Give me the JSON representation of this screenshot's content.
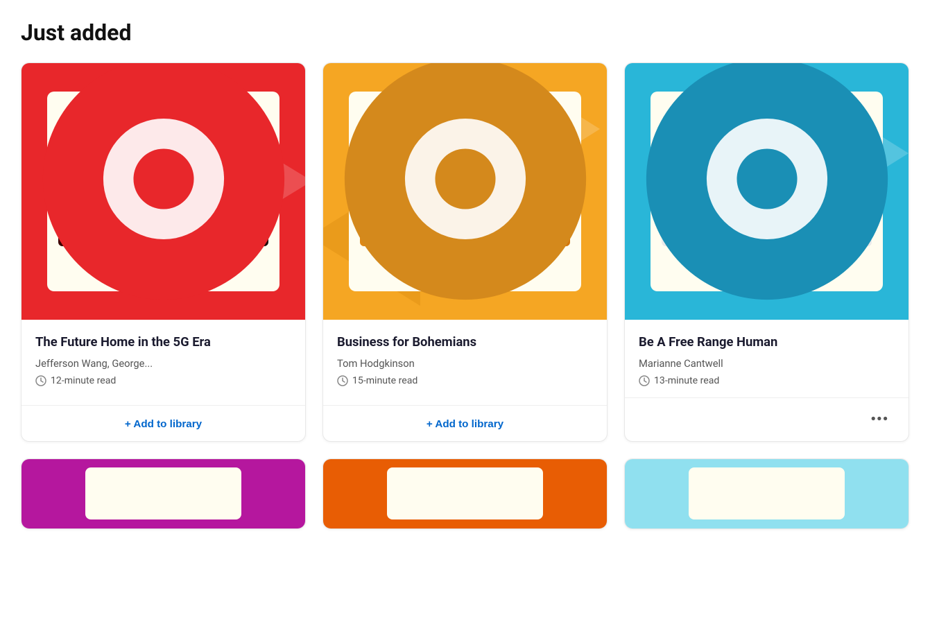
{
  "section": {
    "title": "Just added"
  },
  "cards": [
    {
      "id": "card-1",
      "cover_bg": "red",
      "cover_title": "The Future Home in the 5G Era",
      "title": "The Future Home in the 5G Era",
      "author": "Jefferson Wang, George...",
      "read_time": "12-minute read",
      "action": "+ Add to library"
    },
    {
      "id": "card-2",
      "cover_bg": "orange",
      "cover_title": "Business for Bohemians",
      "title": "Business for Bohemians",
      "author": "Tom Hodgkinson",
      "read_time": "15-minute read",
      "action": "+ Add to library"
    },
    {
      "id": "card-3",
      "cover_bg": "blue",
      "cover_title": "Be a Free Range Human",
      "title": "Be A Free Range Human",
      "author": "Marianne Cantwell",
      "read_time": "13-minute read",
      "action": "..."
    }
  ],
  "bottom_cards": [
    {
      "id": "bottom-1",
      "cover_bg": "purple"
    },
    {
      "id": "bottom-2",
      "cover_bg": "darkorange"
    },
    {
      "id": "bottom-3",
      "cover_bg": "lightblue"
    }
  ]
}
